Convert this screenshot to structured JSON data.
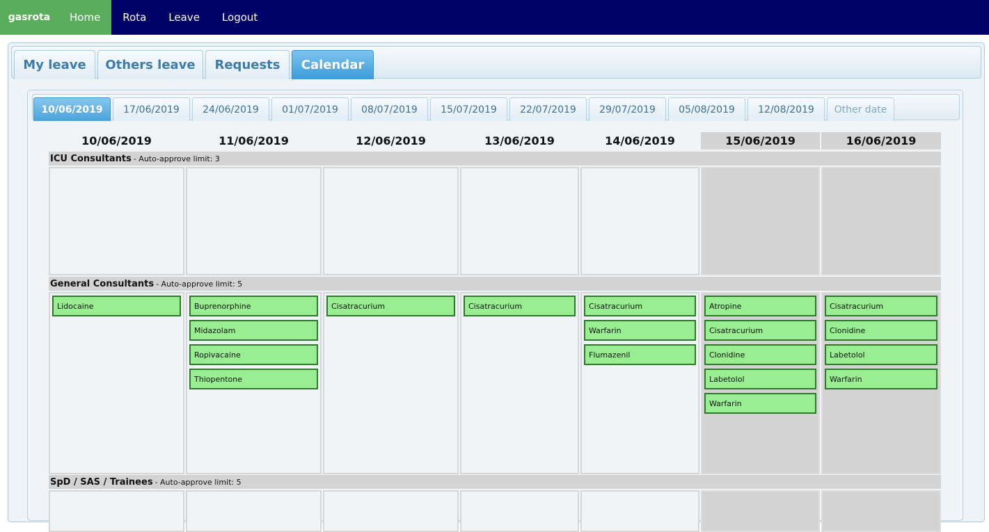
{
  "navbar": {
    "brand": "gasrota",
    "items": [
      {
        "label": "Home",
        "active": true
      },
      {
        "label": "Rota",
        "active": false
      },
      {
        "label": "Leave",
        "active": false
      },
      {
        "label": "Logout",
        "active": false
      }
    ]
  },
  "tabs": [
    {
      "label": "My leave",
      "active": false
    },
    {
      "label": "Others leave",
      "active": false
    },
    {
      "label": "Requests",
      "active": false
    },
    {
      "label": "Calendar",
      "active": true
    }
  ],
  "weeks": [
    {
      "label": "10/06/2019",
      "active": true
    },
    {
      "label": "17/06/2019"
    },
    {
      "label": "24/06/2019"
    },
    {
      "label": "01/07/2019"
    },
    {
      "label": "08/07/2019"
    },
    {
      "label": "15/07/2019"
    },
    {
      "label": "22/07/2019"
    },
    {
      "label": "29/07/2019"
    },
    {
      "label": "05/08/2019"
    },
    {
      "label": "12/08/2019"
    },
    {
      "label": "Other date",
      "muted": true
    }
  ],
  "days": [
    {
      "label": "10/06/2019",
      "weekend": false
    },
    {
      "label": "11/06/2019",
      "weekend": false
    },
    {
      "label": "12/06/2019",
      "weekend": false
    },
    {
      "label": "13/06/2019",
      "weekend": false
    },
    {
      "label": "14/06/2019",
      "weekend": false
    },
    {
      "label": "15/06/2019",
      "weekend": true
    },
    {
      "label": "16/06/2019",
      "weekend": true
    }
  ],
  "groups": [
    {
      "name": "ICU Consultants",
      "limit": "- Auto-approve limit: 3",
      "leave": [
        [],
        [],
        [],
        [],
        [],
        [],
        []
      ]
    },
    {
      "name": "General Consultants",
      "limit": "- Auto-approve limit: 5",
      "leave": [
        [
          "Lidocaine"
        ],
        [
          "Buprenorphine",
          "Midazolam",
          "Ropivacaine",
          "Thiopentone"
        ],
        [
          "Cisatracurium"
        ],
        [
          "Cisatracurium"
        ],
        [
          "Cisatracurium",
          "Warfarin",
          "Flumazenil"
        ],
        [
          "Atropine",
          "Cisatracurium",
          "Clonidine",
          "Labetolol",
          "Warfarin"
        ],
        [
          "Cisatracurium",
          "Clonidine",
          "Labetolol",
          "Warfarin"
        ]
      ]
    },
    {
      "name": "SpD / SAS / Trainees",
      "limit": "- Auto-approve limit: 5",
      "leave": [
        [],
        [],
        [],
        [],
        [],
        [],
        []
      ]
    }
  ]
}
